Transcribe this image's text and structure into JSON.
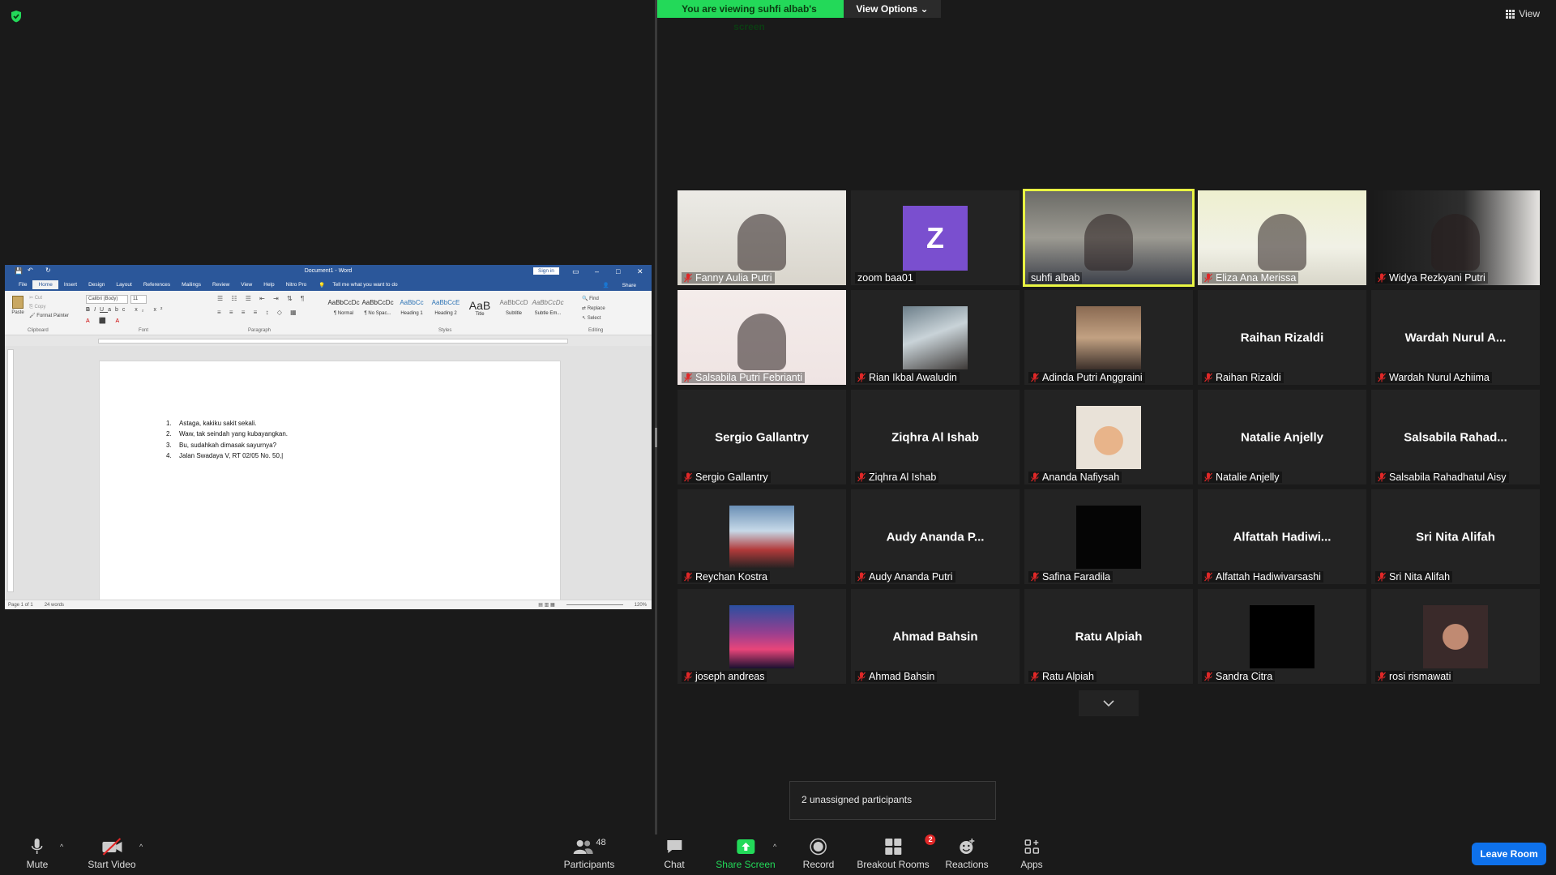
{
  "banner": {
    "text": "You are viewing suhfi albab's screen",
    "view_options": "View Options"
  },
  "top_view": "View",
  "word": {
    "title": "Document1 - Word",
    "sign_in": "Sign in",
    "tabs": [
      "File",
      "Home",
      "Insert",
      "Design",
      "Layout",
      "References",
      "Mailings",
      "Review",
      "View",
      "Help",
      "Nitro Pro"
    ],
    "tell_me": "Tell me what you want to do",
    "share": "Share",
    "clipboard": {
      "paste": "Paste",
      "cut": "Cut",
      "copy": "Copy",
      "format_painter": "Format Painter",
      "group": "Clipboard"
    },
    "font": {
      "name": "Calibri (Body)",
      "size": "11",
      "group": "Font"
    },
    "paragraph_group": "Paragraph",
    "styles": [
      {
        "sample": "AaBbCcDc",
        "name": "¶ Normal"
      },
      {
        "sample": "AaBbCcDc",
        "name": "¶ No Spac..."
      },
      {
        "sample": "AaBbCc",
        "name": "Heading 1"
      },
      {
        "sample": "AaBbCcE",
        "name": "Heading 2"
      },
      {
        "sample": "AaB",
        "name": "Title"
      },
      {
        "sample": "AaBbCcD",
        "name": "Subtitle"
      },
      {
        "sample": "AaBbCcDc",
        "name": "Subtle Em..."
      }
    ],
    "styles_group": "Styles",
    "editing": {
      "find": "Find",
      "replace": "Replace",
      "select": "Select",
      "group": "Editing"
    },
    "list": [
      {
        "n": "1.",
        "text": "Astaga, kakiku sakit sekali."
      },
      {
        "n": "2.",
        "text": "Waw, tak seindah yang kubayangkan."
      },
      {
        "n": "3.",
        "text": "Bu, sudahkah dimasak sayurnya?"
      },
      {
        "n": "4.",
        "text": "Jalan Swadaya V, RT 02/05 No. 50,"
      }
    ],
    "status": {
      "page": "Page 1 of 1",
      "words": "24 words",
      "zoom": "120%"
    }
  },
  "participants": [
    {
      "name": "Fanny Aulia Putri",
      "video": true,
      "muted": true
    },
    {
      "name": "zoom baa01",
      "avatar": "Z",
      "muted": false
    },
    {
      "name": "suhfi albab",
      "video": true,
      "muted": false,
      "active": true
    },
    {
      "name": "Eliza Ana Merissa",
      "video": true,
      "muted": true
    },
    {
      "name": "Widya Rezkyani Putri",
      "video": true,
      "muted": true
    },
    {
      "name": "Salsabila Putri Febrianti",
      "video": true,
      "muted": true
    },
    {
      "name": "Rian Ikbal Awaludin",
      "thumb": true,
      "muted": true
    },
    {
      "name": "Adinda Putri Anggraini",
      "thumb": true,
      "muted": true
    },
    {
      "name": "Raihan Rizaldi",
      "center": "Raihan Rizaldi",
      "muted": true
    },
    {
      "name": "Wardah Nurul Azhiima",
      "center": "Wardah  Nurul  A...",
      "muted": true
    },
    {
      "name": "Sergio Gallantry",
      "center": "Sergio Gallantry",
      "muted": true
    },
    {
      "name": "Ziqhra Al Ishab",
      "center": "Ziqhra Al Ishab",
      "muted": true
    },
    {
      "name": "Ananda Nafiysah",
      "thumb": true,
      "muted": true
    },
    {
      "name": "Natalie Anjelly",
      "center": "Natalie Anjelly",
      "muted": true
    },
    {
      "name": "Salsabila Rahadhatul Aisy",
      "center": "Salsabila  Rahad...",
      "muted": true
    },
    {
      "name": "Reychan Kostra",
      "thumb": true,
      "muted": true
    },
    {
      "name": "Audy Ananda Putri",
      "center": "Audy  Ananda  P...",
      "muted": true
    },
    {
      "name": "Safina Faradila",
      "thumb": true,
      "muted": true
    },
    {
      "name": "Alfattah Hadiwivarsashi",
      "center": "Alfattah  Hadiwi...",
      "muted": true
    },
    {
      "name": "Sri Nita Alifah",
      "center": "Sri Nita Alifah",
      "muted": true
    },
    {
      "name": "joseph andreas",
      "thumb": true,
      "muted": true
    },
    {
      "name": "Ahmad Bahsin",
      "center": "Ahmad Bahsin",
      "muted": true
    },
    {
      "name": "Ratu Alpiah",
      "center": "Ratu Alpiah",
      "muted": true
    },
    {
      "name": "Sandra Citra",
      "thumb": true,
      "muted": true
    },
    {
      "name": "rosi rismawati",
      "thumb": true,
      "muted": true
    }
  ],
  "unassigned": "2 unassigned participants",
  "toolbar": {
    "mute": "Mute",
    "start_video": "Start Video",
    "participants": "Participants",
    "participants_count": "48",
    "chat": "Chat",
    "share_screen": "Share Screen",
    "record": "Record",
    "breakout_rooms": "Breakout Rooms",
    "breakout_badge": "2",
    "reactions": "Reactions",
    "apps": "Apps",
    "leave_room": "Leave Room"
  },
  "colors": {
    "accent_green": "#23d959",
    "active_outline": "#e9f542",
    "leave_blue": "#0e71eb",
    "word_blue": "#2b579a"
  }
}
